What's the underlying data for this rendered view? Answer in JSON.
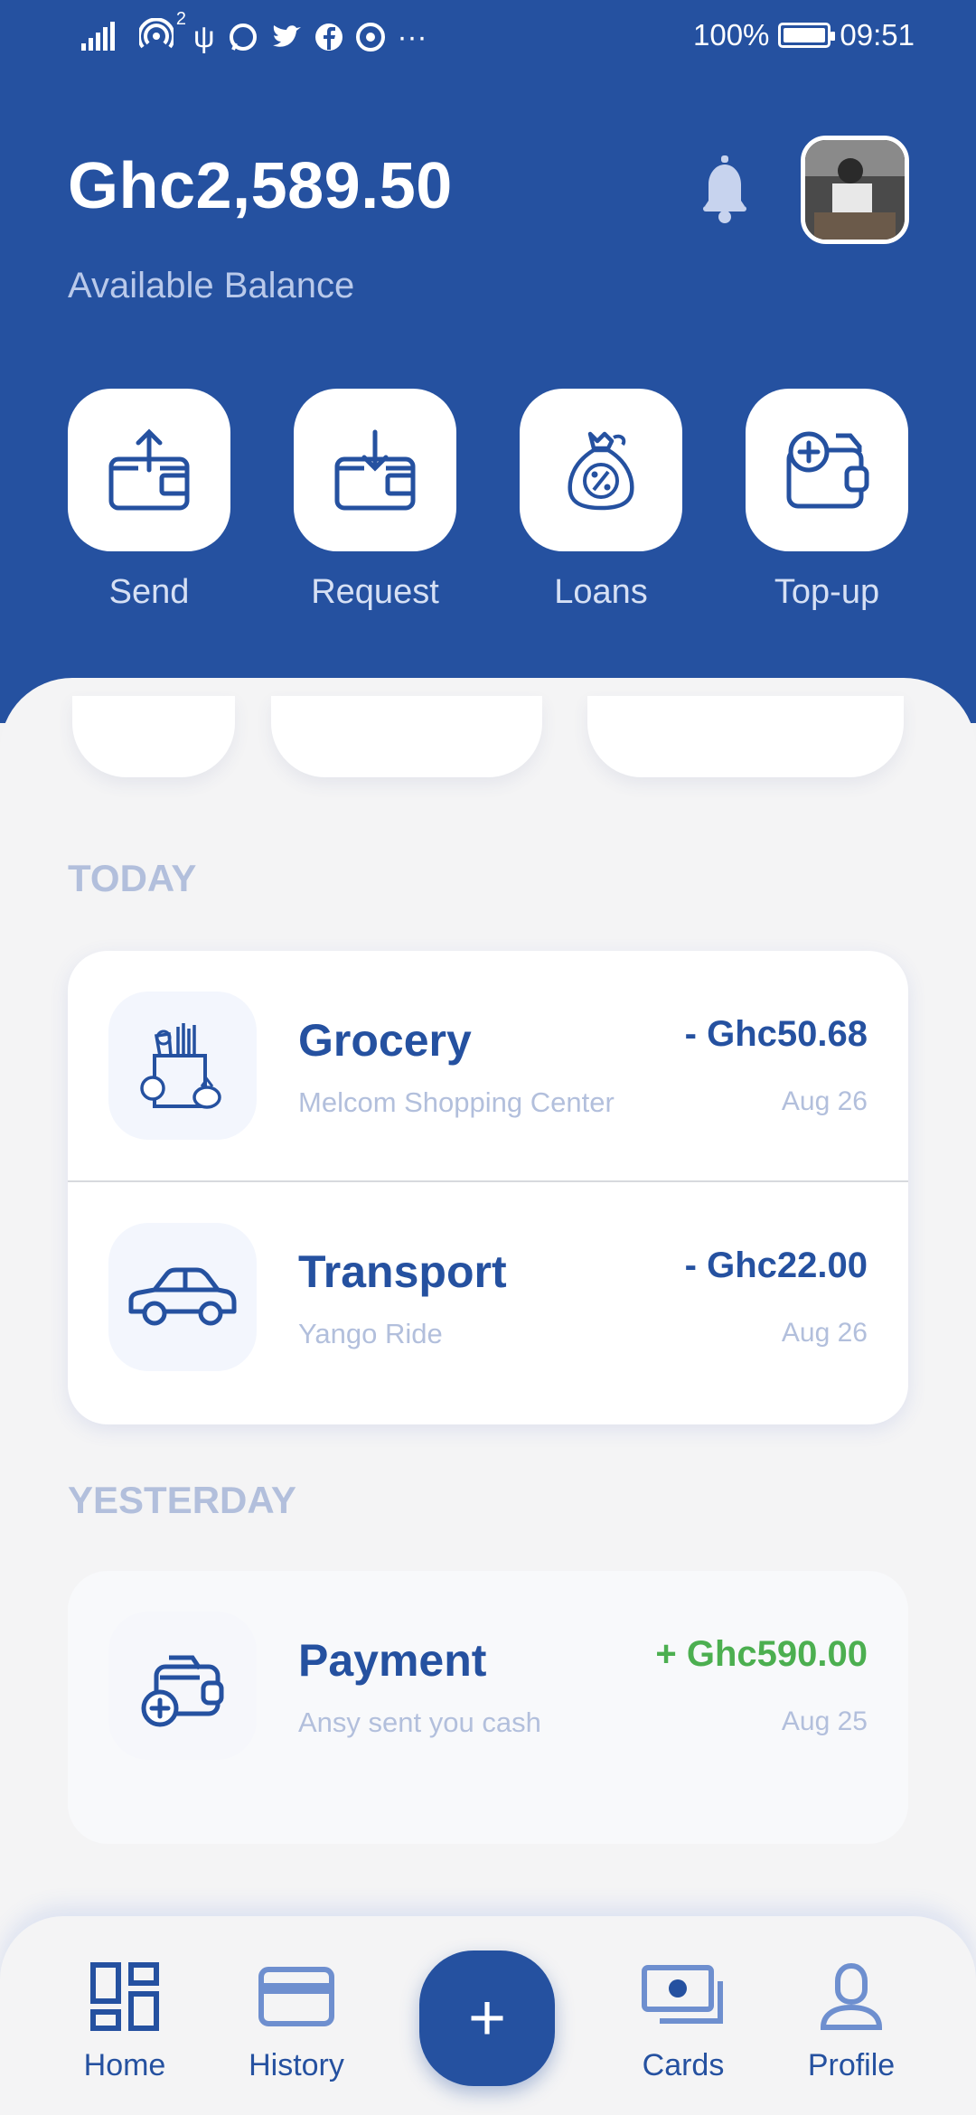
{
  "status_bar": {
    "battery": "100%",
    "time": "09:51",
    "signal_superscript": "2"
  },
  "header": {
    "balance": "Ghc2,589.50",
    "balance_label": "Available Balance"
  },
  "actions": [
    {
      "label": "Send",
      "icon": "wallet-send-icon"
    },
    {
      "label": "Request",
      "icon": "wallet-receive-icon"
    },
    {
      "label": "Loans",
      "icon": "money-bag-percent-icon"
    },
    {
      "label": "Top-up",
      "icon": "wallet-plus-icon"
    }
  ],
  "sections": {
    "today": "TODAY",
    "yesterday": "YESTERDAY"
  },
  "transactions": {
    "today": [
      {
        "title": "Grocery",
        "subtitle": "Melcom Shopping Center",
        "amount": "- Ghc50.68",
        "date": "Aug 26",
        "icon": "grocery-bag-icon"
      },
      {
        "title": "Transport",
        "subtitle": "Yango Ride",
        "amount": "- Ghc22.00",
        "date": "Aug 26",
        "icon": "car-icon"
      }
    ],
    "yesterday": [
      {
        "title": "Payment",
        "subtitle": "Ansy sent you cash",
        "amount": "+ Ghc590.00",
        "date": "Aug 25",
        "icon": "wallet-add-icon"
      }
    ]
  },
  "nav": {
    "home": "Home",
    "history": "History",
    "fab": "+",
    "cards": "Cards",
    "profile": "Profile"
  },
  "colors": {
    "brand": "#2551a0",
    "positive": "#4caf50",
    "muted": "#b2bfdc"
  }
}
